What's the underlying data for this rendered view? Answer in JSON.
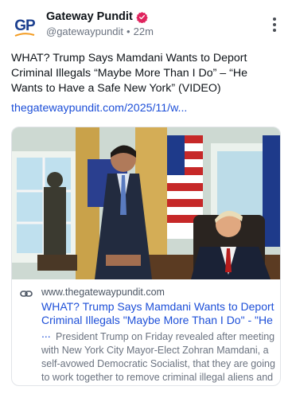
{
  "account": {
    "monogram": "GP",
    "display_name": "Gateway Pundit",
    "handle": "@gatewaypundit",
    "separator": "•",
    "time_ago": "22m",
    "verified_color": "#e0245e"
  },
  "post": {
    "text": "WHAT? Trump Says Mamdani Wants to Deport Criminal Illegals “Maybe More Than I Do” – “He Wants to Have a Safe New York” (VIDEO)",
    "link_text": "thegatewaypundit.com/2025/11/w..."
  },
  "link_card": {
    "domain": "www.thegatewaypundit.com",
    "title": "WHAT? Trump Says Mamdani Wants to Deport Criminal Illegals \"Maybe More Than I Do\" - \"He ...",
    "description": "President Trump on Friday revealed after meeting with New York City Mayor-Elect Zohran Mamdani, a self-avowed Democratic Socialist, that they are going to work together to remove criminal illegal aliens and ...",
    "image_icon": "news-photo"
  },
  "colors": {
    "link": "#1d4fd8",
    "brand_blue": "#1b3f8f",
    "brand_orange": "#f39a1e"
  }
}
